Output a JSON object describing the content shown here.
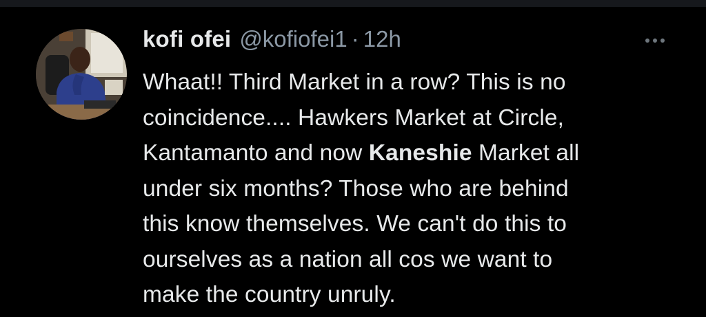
{
  "tweet": {
    "author": {
      "display_name": "kofi ofei",
      "handle": "@kofiofei1",
      "avatar_icon": "profile-photo"
    },
    "separator": "·",
    "timestamp": "12h",
    "more_icon": "ellipsis-icon",
    "text_lines": [
      [
        "Whaat!! Third Market in a row? This is no"
      ],
      [
        "coincidence.... Hawkers Market at Circle,"
      ],
      [
        "Kantamanto and now ",
        "Kaneshie",
        " Market all"
      ],
      [
        "under six months? Those who are behind"
      ],
      [
        "this know themselves. We can't do this to"
      ],
      [
        "ourselves as a nation all cos we want to"
      ],
      [
        "make the country unruly."
      ]
    ],
    "colors": {
      "background": "#000000",
      "primary_text": "#e7e9ea",
      "secondary_text": "#8b98a5",
      "divider": "#16181c"
    }
  }
}
